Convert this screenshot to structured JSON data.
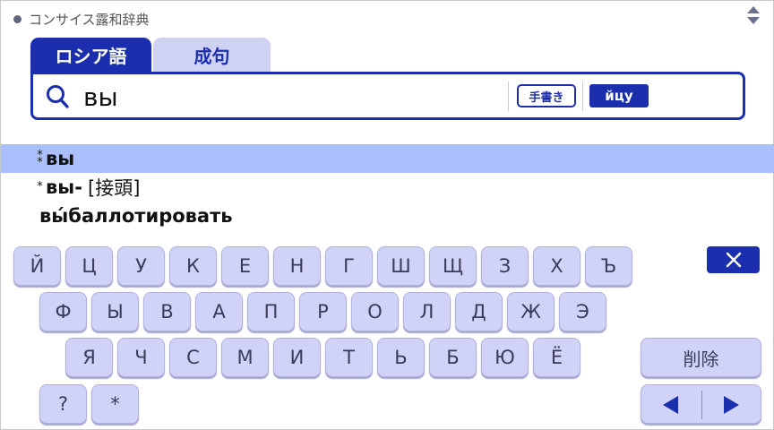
{
  "header": {
    "title": "コンサイス露和辞典"
  },
  "tabs": [
    {
      "label": "ロシア語"
    },
    {
      "label": "成句"
    }
  ],
  "search": {
    "query": "вы",
    "handwriting_label": "手書き",
    "layout_label": "йцу"
  },
  "results": [
    {
      "mark": "⁑",
      "word": "вы",
      "tag": ""
    },
    {
      "mark": "*",
      "word": "вы-",
      "tag": "[接頭]"
    },
    {
      "mark": "",
      "word": "вы́баллотировать",
      "tag": ""
    }
  ],
  "keyboard": {
    "row1": [
      "Й",
      "Ц",
      "У",
      "К",
      "Е",
      "Н",
      "Г",
      "Ш",
      "Щ",
      "З",
      "Х",
      "Ъ"
    ],
    "row2": [
      "Ф",
      "Ы",
      "В",
      "А",
      "П",
      "Р",
      "О",
      "Л",
      "Д",
      "Ж",
      "Э"
    ],
    "row3": [
      "Я",
      "Ч",
      "С",
      "М",
      "И",
      "Т",
      "Ь",
      "Б",
      "Ю",
      "Ё"
    ],
    "row4": [
      "?",
      "*"
    ],
    "delete_label": "削除"
  },
  "colors": {
    "accent": "#1b2fae",
    "key_bg": "#d1d2f7",
    "selection": "#abbffc"
  }
}
